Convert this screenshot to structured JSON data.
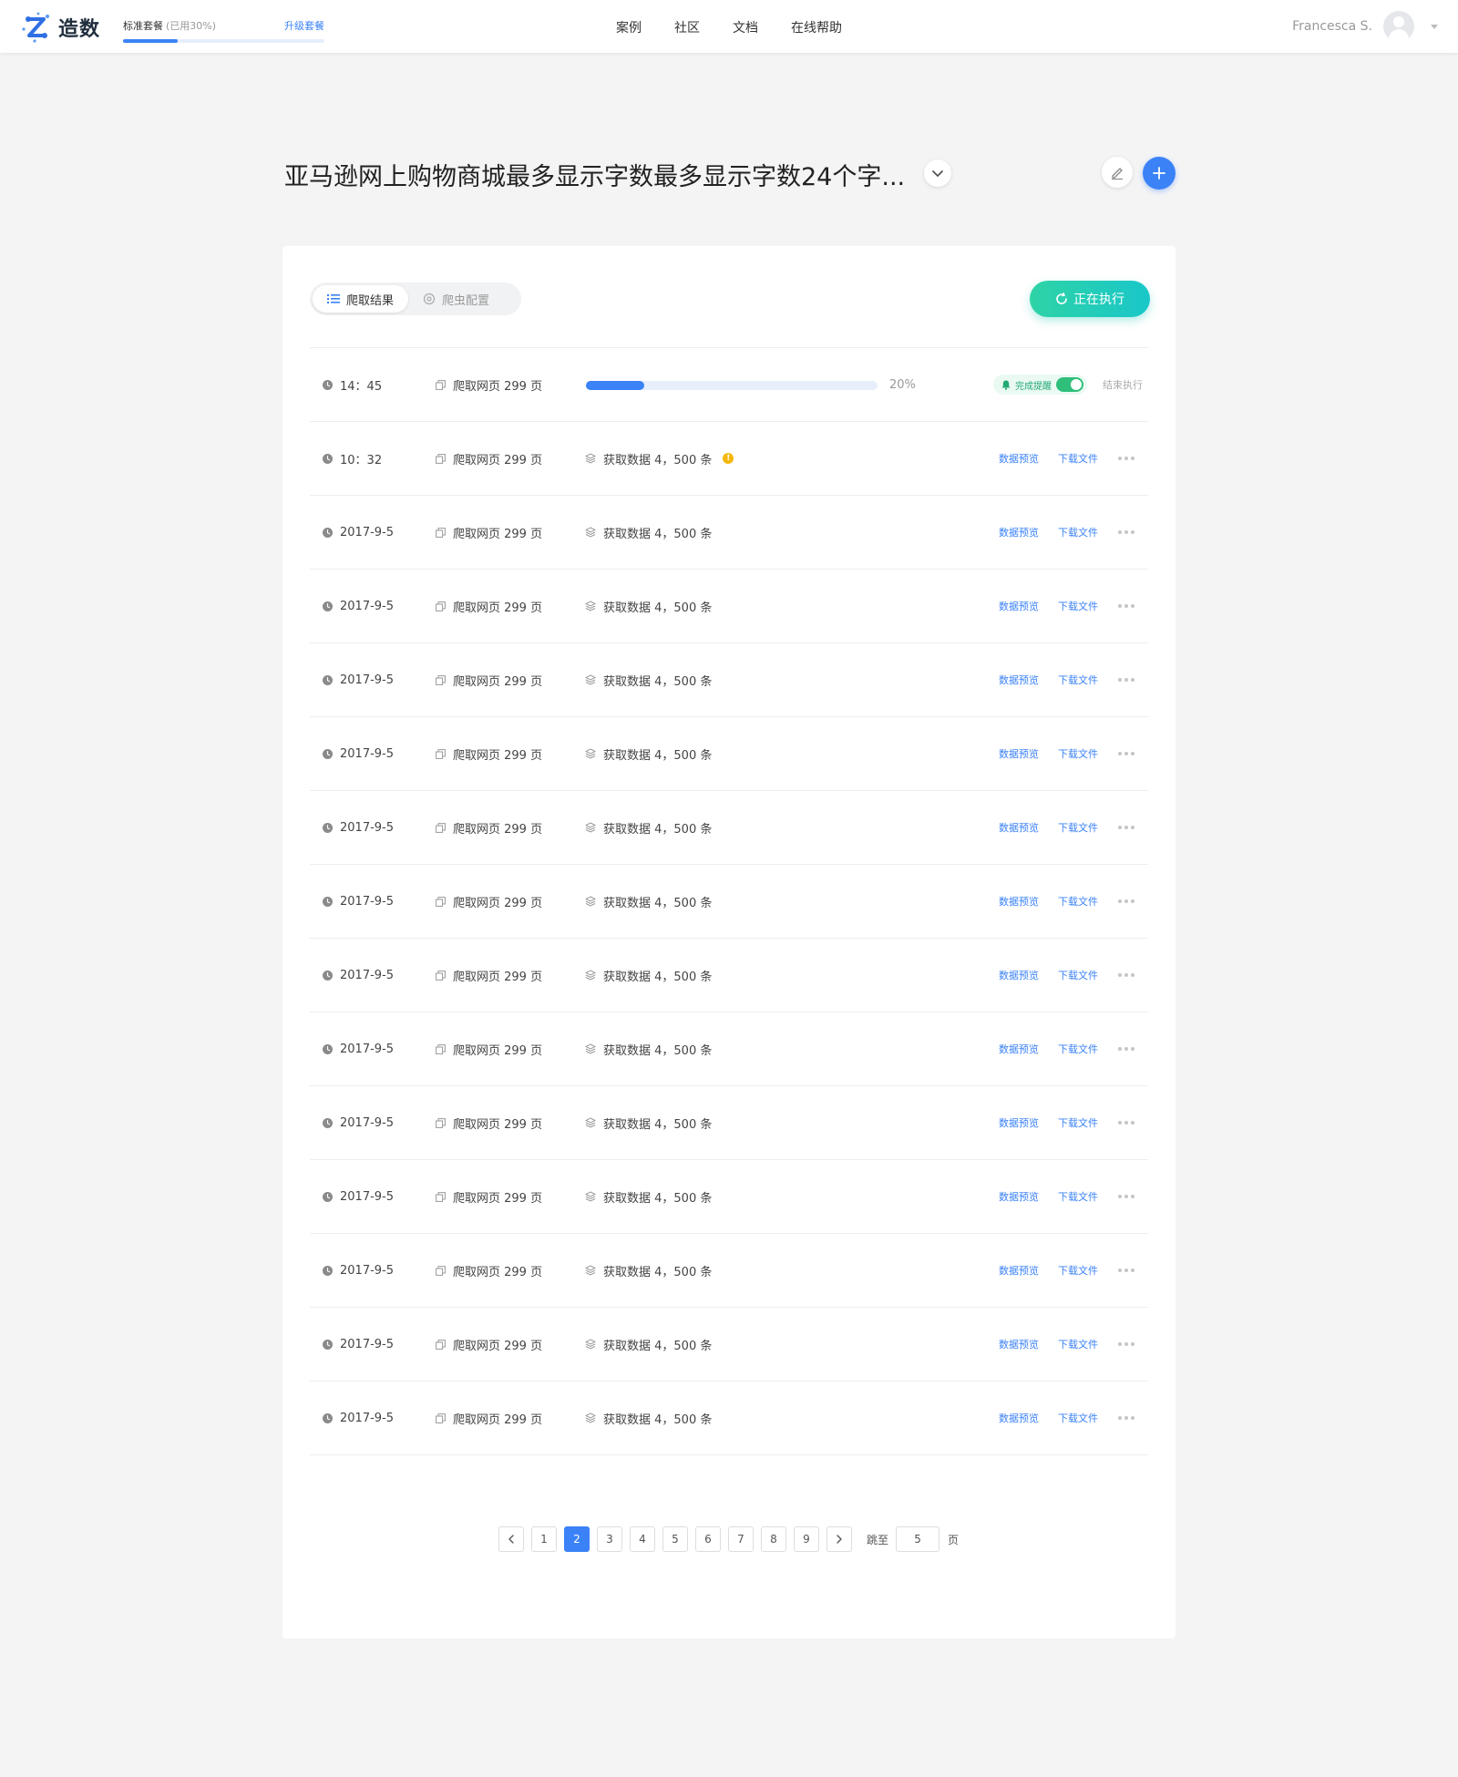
{
  "header": {
    "logo_text": "造数",
    "plan": {
      "name": "标准套餐",
      "used": "(已用30%)",
      "upgrade": "升级套餐",
      "used_fraction": 0.27
    },
    "nav": [
      "案例",
      "社区",
      "文档",
      "在线帮助"
    ],
    "user_name": "Francesca S."
  },
  "page": {
    "title": "亚马逊网上购物商城最多显示字数最多显示字数24个字..."
  },
  "tabs": {
    "results": "爬取结果",
    "config": "爬虫配置"
  },
  "run_button": "正在执行",
  "running_row": {
    "time": "14：45",
    "pages": "爬取网页 299 页",
    "progress": 0.2,
    "progress_label": "20%",
    "notify_label": "完成提醒",
    "notify_on": true,
    "end_label": "结束执行"
  },
  "actions": {
    "preview": "数据预览",
    "download": "下载文件"
  },
  "rows": [
    {
      "time": "10：32",
      "pages": "爬取网页 299 页",
      "data": "获取数据 4，500 条",
      "warning": true
    },
    {
      "time": "2017-9-5",
      "pages": "爬取网页 299 页",
      "data": "获取数据 4，500 条",
      "warning": false
    },
    {
      "time": "2017-9-5",
      "pages": "爬取网页 299 页",
      "data": "获取数据 4，500 条",
      "warning": false
    },
    {
      "time": "2017-9-5",
      "pages": "爬取网页 299 页",
      "data": "获取数据 4，500 条",
      "warning": false
    },
    {
      "time": "2017-9-5",
      "pages": "爬取网页 299 页",
      "data": "获取数据 4，500 条",
      "warning": false
    },
    {
      "time": "2017-9-5",
      "pages": "爬取网页 299 页",
      "data": "获取数据 4，500 条",
      "warning": false
    },
    {
      "time": "2017-9-5",
      "pages": "爬取网页 299 页",
      "data": "获取数据 4，500 条",
      "warning": false
    },
    {
      "time": "2017-9-5",
      "pages": "爬取网页 299 页",
      "data": "获取数据 4，500 条",
      "warning": false
    },
    {
      "time": "2017-9-5",
      "pages": "爬取网页 299 页",
      "data": "获取数据 4，500 条",
      "warning": false
    },
    {
      "time": "2017-9-5",
      "pages": "爬取网页 299 页",
      "data": "获取数据 4，500 条",
      "warning": false
    },
    {
      "time": "2017-9-5",
      "pages": "爬取网页 299 页",
      "data": "获取数据 4，500 条",
      "warning": false
    },
    {
      "time": "2017-9-5",
      "pages": "爬取网页 299 页",
      "data": "获取数据 4，500 条",
      "warning": false
    },
    {
      "time": "2017-9-5",
      "pages": "爬取网页 299 页",
      "data": "获取数据 4，500 条",
      "warning": false
    },
    {
      "time": "2017-9-5",
      "pages": "爬取网页 299 页",
      "data": "获取数据 4，500 条",
      "warning": false
    }
  ],
  "pagination": {
    "pages": [
      "1",
      "2",
      "3",
      "4",
      "5",
      "6",
      "7",
      "8",
      "9"
    ],
    "current": "2",
    "jump_label": "跳至",
    "jump_value": "5",
    "page_word": "页"
  },
  "colors": {
    "primary": "#3b82f6",
    "success": "#2fbf7a",
    "run_gradient_start": "#2ed3a6",
    "run_gradient_end": "#19c7c9",
    "warning": "#f5b70a"
  }
}
